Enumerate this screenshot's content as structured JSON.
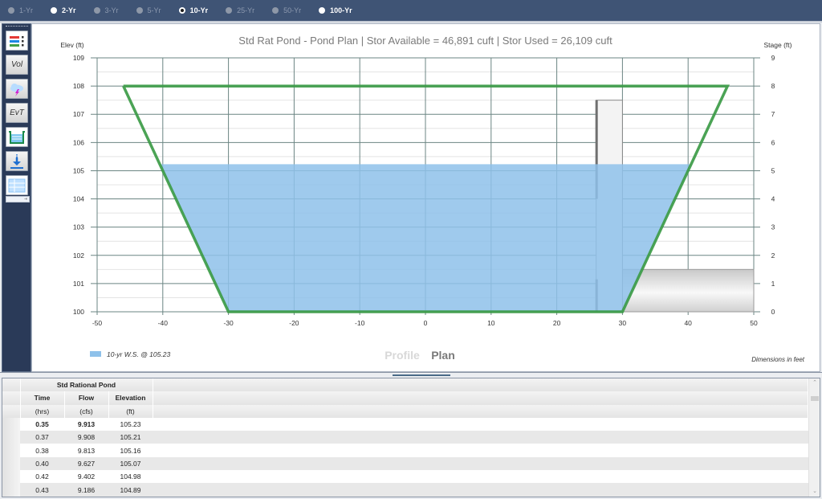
{
  "storm_selector": {
    "options": [
      {
        "label": "1-Yr",
        "enabled": false,
        "selected": false
      },
      {
        "label": "2-Yr",
        "enabled": true,
        "selected": false
      },
      {
        "label": "3-Yr",
        "enabled": false,
        "selected": false
      },
      {
        "label": "5-Yr",
        "enabled": false,
        "selected": false
      },
      {
        "label": "10-Yr",
        "enabled": true,
        "selected": true
      },
      {
        "label": "25-Yr",
        "enabled": false,
        "selected": false
      },
      {
        "label": "50-Yr",
        "enabled": false,
        "selected": false
      },
      {
        "label": "100-Yr",
        "enabled": true,
        "selected": false
      }
    ]
  },
  "toolbar": {
    "buttons": [
      {
        "name": "legend-colors",
        "icon": "color-bars-icon",
        "label": ""
      },
      {
        "name": "volume",
        "icon": "",
        "label": "Vol"
      },
      {
        "name": "storm",
        "icon": "storm-cloud-icon",
        "label": ""
      },
      {
        "name": "event",
        "icon": "",
        "label": "EvT"
      },
      {
        "name": "pond",
        "icon": "pond-icon",
        "label": ""
      },
      {
        "name": "download",
        "icon": "download-icon",
        "label": ""
      },
      {
        "name": "table",
        "icon": "table-icon",
        "label": ""
      }
    ],
    "footer_glyph": "⇥"
  },
  "chart_data": {
    "type": "area",
    "title": "Std Rat Pond - Pond Plan | Stor Available = 46,891 cuft | Stor Used = 26,109 cuft",
    "ylabel": "Elev (ft)",
    "y2label": "Stage (ft)",
    "xlabel": "",
    "xlim": [
      -50,
      50
    ],
    "ylim": [
      100,
      109
    ],
    "y2lim": [
      0,
      9
    ],
    "x_ticks": [
      -50,
      -40,
      -30,
      -20,
      -10,
      0,
      10,
      20,
      30,
      40,
      50
    ],
    "y_ticks": [
      100,
      101,
      102,
      103,
      104,
      105,
      106,
      107,
      108,
      109
    ],
    "y2_ticks": [
      0,
      1,
      2,
      3,
      4,
      5,
      6,
      7,
      8,
      9
    ],
    "grid": true,
    "minor_grid_step": 0.5,
    "pond_outline": {
      "x": [
        -46,
        -30,
        30,
        46,
        -46
      ],
      "y": [
        108,
        100,
        100,
        108,
        108
      ],
      "color": "#3c9b46"
    },
    "water_surface": {
      "elevation": 105.23,
      "color": "#8ec1ea"
    },
    "riser": {
      "x": [
        26,
        30
      ],
      "top": 107.5,
      "bottom": 100
    },
    "riser_openings": [
      {
        "from": 104,
        "to": 107.5
      },
      {
        "from": 100,
        "to": 101.15
      }
    ],
    "outlet_pipe": {
      "x": [
        30,
        50
      ],
      "bottom": 100,
      "top": 101.5
    },
    "legend": [
      {
        "label": "10-yr W.S. @ 105.23",
        "color": "#8ec1ea"
      }
    ],
    "legend_position": "bottom-left",
    "view_tabs": [
      {
        "label": "Profile",
        "active": false
      },
      {
        "label": "Plan",
        "active": true
      }
    ],
    "note": "Dimensions in feet"
  },
  "table": {
    "group_header": "Std Rational Pond",
    "columns": [
      {
        "name": "Time",
        "unit": "(hrs)"
      },
      {
        "name": "Flow",
        "unit": "(cfs)"
      },
      {
        "name": "Elevation",
        "unit": "(ft)"
      }
    ],
    "rows": [
      [
        "0.35",
        "9.913",
        "105.23"
      ],
      [
        "0.37",
        "9.908",
        "105.21"
      ],
      [
        "0.38",
        "9.813",
        "105.16"
      ],
      [
        "0.40",
        "9.627",
        "105.07"
      ],
      [
        "0.42",
        "9.402",
        "104.98"
      ],
      [
        "0.43",
        "9.186",
        "104.89"
      ]
    ],
    "highlight_row": 0
  }
}
